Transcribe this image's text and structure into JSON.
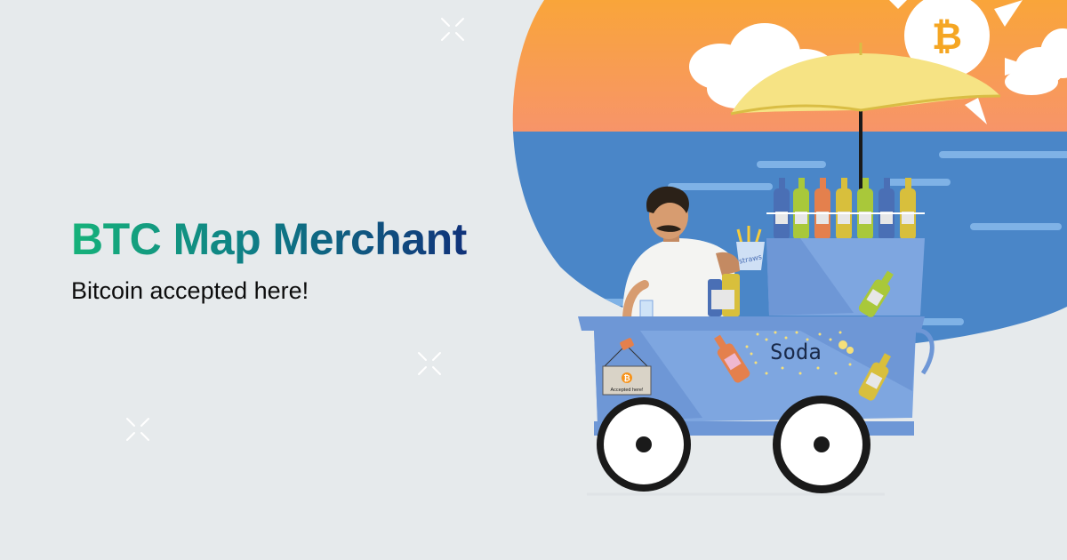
{
  "headline": "BTC Map Merchant",
  "tagline": "Bitcoin accepted here!",
  "cart": {
    "sign_text": "Accepted here!",
    "soda_label": "Soda",
    "straws_label": "straws",
    "bitcoin_symbol": "₿"
  },
  "colors": {
    "background": "#e6eaec",
    "headline_gradient_start": "#16b27a",
    "headline_gradient_end": "#10327a",
    "sky_orange": "#f89f5e",
    "sea_blue": "#4a86c8",
    "cart_blue": "#7ea6e0",
    "bitcoin_orange": "#f7931a"
  }
}
